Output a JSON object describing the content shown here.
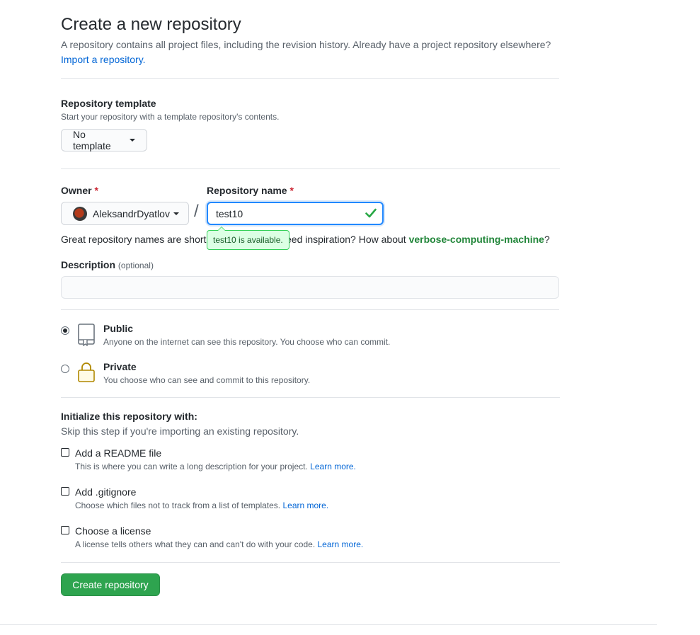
{
  "header": {
    "title": "Create a new repository",
    "subtitle": "A repository contains all project files, including the revision history. Already have a project repository elsewhere?",
    "import_link": "Import a repository."
  },
  "template": {
    "label": "Repository template",
    "hint": "Start your repository with a template repository's contents.",
    "selected": "No template"
  },
  "owner": {
    "label": "Owner",
    "required_mark": "*",
    "value": "AleksandrDyatlov"
  },
  "separator": "/",
  "repo_name": {
    "label": "Repository name",
    "required_mark": "*",
    "value": "test10",
    "tooltip": "test10 is available."
  },
  "name_hint": {
    "before": "Great repository names are short",
    "after": "eed inspiration? How about",
    "suggestion": "verbose-computing-machine",
    "end": "?"
  },
  "description": {
    "label": "Description",
    "optional": "(optional)",
    "value": ""
  },
  "visibility": {
    "public": {
      "label": "Public",
      "hint": "Anyone on the internet can see this repository. You choose who can commit.",
      "checked": true
    },
    "private": {
      "label": "Private",
      "hint": "You choose who can see and commit to this repository.",
      "checked": false
    }
  },
  "init": {
    "title": "Initialize this repository with:",
    "hint": "Skip this step if you're importing an existing repository.",
    "options": [
      {
        "label": "Add a README file",
        "hint": "This is where you can write a long description for your project.",
        "link": "Learn more."
      },
      {
        "label": "Add .gitignore",
        "hint": "Choose which files not to track from a list of templates.",
        "link": "Learn more."
      },
      {
        "label": "Choose a license",
        "hint": "A license tells others what they can and can't do with your code.",
        "link": "Learn more."
      }
    ]
  },
  "submit": {
    "label": "Create repository"
  },
  "colors": {
    "accent": "#2ea44f",
    "link": "#0366d6",
    "required": "#cb2431",
    "success_bg": "#dcffe4"
  }
}
